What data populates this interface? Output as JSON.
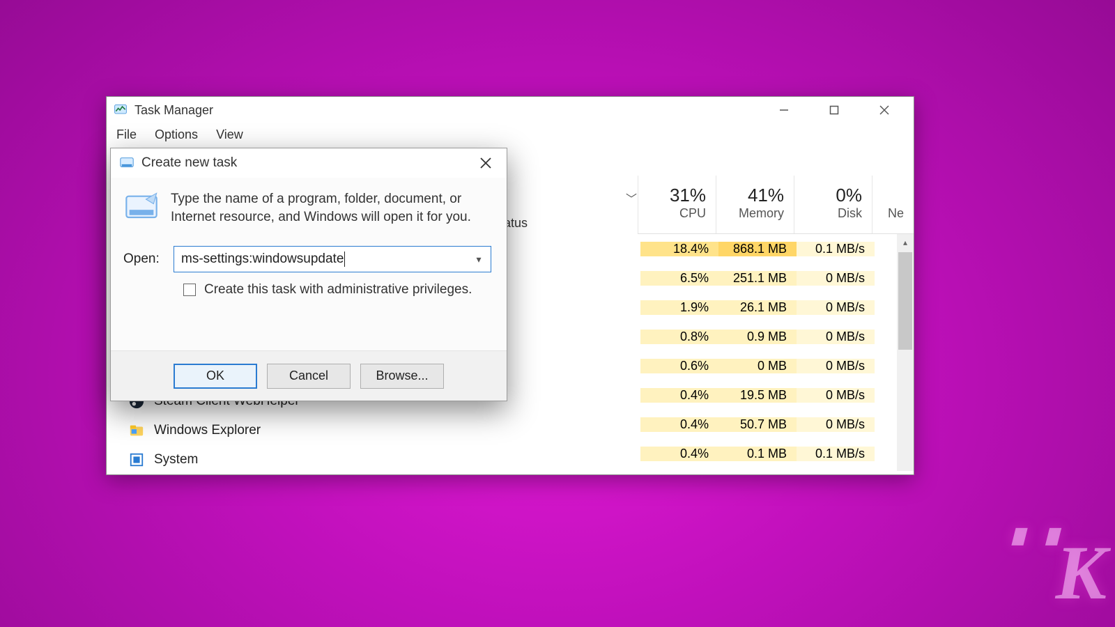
{
  "task_manager": {
    "title": "Task Manager",
    "menu": {
      "file": "File",
      "options": "Options",
      "view": "View"
    },
    "status_fragment": "atus",
    "columns": {
      "cpu": {
        "pct": "31%",
        "label": "CPU"
      },
      "memory": {
        "pct": "41%",
        "label": "Memory"
      },
      "disk": {
        "pct": "0%",
        "label": "Disk"
      },
      "net": {
        "label": "Ne"
      }
    },
    "rows": [
      {
        "cpu": "18.4%",
        "mem": "868.1 MB",
        "disk": "0.1 MB/s"
      },
      {
        "cpu": "6.5%",
        "mem": "251.1 MB",
        "disk": "0 MB/s"
      },
      {
        "cpu": "1.9%",
        "mem": "26.1 MB",
        "disk": "0 MB/s"
      },
      {
        "cpu": "0.8%",
        "mem": "0.9 MB",
        "disk": "0 MB/s"
      },
      {
        "cpu": "0.6%",
        "mem": "0 MB",
        "disk": "0 MB/s"
      },
      {
        "cpu": "0.4%",
        "mem": "19.5 MB",
        "disk": "0 MB/s"
      },
      {
        "cpu": "0.4%",
        "mem": "50.7 MB",
        "disk": "0 MB/s"
      },
      {
        "cpu": "0.4%",
        "mem": "0.1 MB",
        "disk": "0.1 MB/s"
      }
    ],
    "processes": [
      {
        "name": "Steam Client WebHelper",
        "icon": "steam"
      },
      {
        "name": "Windows Explorer",
        "icon": "explorer"
      },
      {
        "name": "System",
        "icon": "system"
      }
    ]
  },
  "run_dialog": {
    "title": "Create new task",
    "message": "Type the name of a program, folder, document, or Internet resource, and Windows will open it for you.",
    "open_label": "Open:",
    "open_value": "ms-settings:windowsupdate",
    "admin_cb_label": "Create this task with administrative privileges.",
    "buttons": {
      "ok": "OK",
      "cancel": "Cancel",
      "browse": "Browse..."
    }
  }
}
